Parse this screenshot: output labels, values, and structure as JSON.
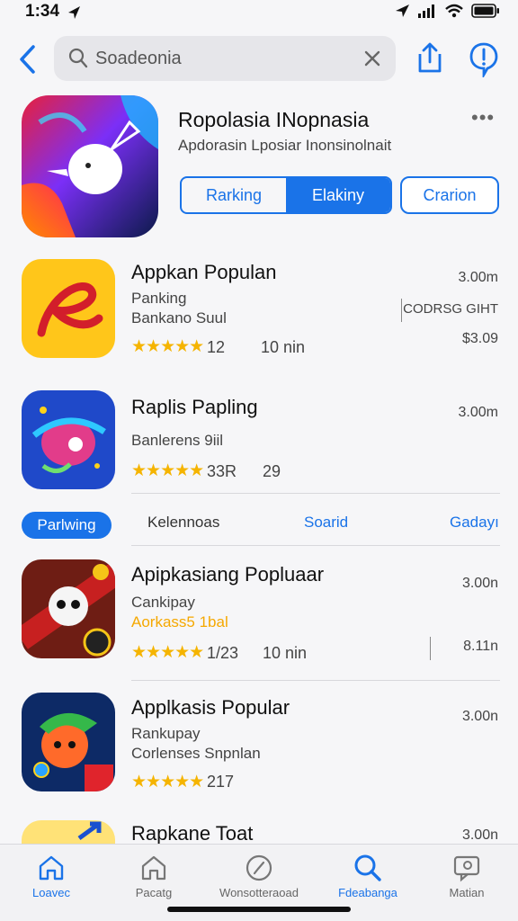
{
  "status": {
    "time": "1:34"
  },
  "search": {
    "value": "Soadeonia"
  },
  "hero": {
    "title": "Ropolasia INopnasia",
    "subtitle": "Apdorasin Lposiar Inonsinolnait",
    "more": "•••",
    "segments": [
      "Rarking",
      "Elakiny"
    ],
    "extra_button": "Crarion"
  },
  "apps": [
    {
      "title": "Appkan Populan",
      "line1": "Panking",
      "line2": "Bankano Suul",
      "rating": "12",
      "meta": "10 nin",
      "price": "3.00m",
      "right2": "CODRSG GIHT",
      "right3": "$3.09"
    },
    {
      "title": "Raplis Papling",
      "line1": "Banlerens 9iil",
      "rating": "33R",
      "meta": "29",
      "price": "3.00m"
    },
    {
      "title": "Apipkasiang Popluaar",
      "line1": "Cankipay",
      "line2": "Aorkass5 1bal",
      "rating": "1/23",
      "meta": "10 nin",
      "price": "3.00n",
      "right2": "8.11n"
    },
    {
      "title": "Applkasis Popular",
      "line1": "Rankupay",
      "line2": "Corlenses Snpnlan",
      "rating": "217",
      "price": "3.00n"
    },
    {
      "title": "Rapkane Toat",
      "price": "3.00n"
    }
  ],
  "tabs": {
    "active": "Parlwing",
    "items": [
      "Kelennoas",
      "Soarid",
      "Gadayı"
    ]
  },
  "bottom_nav": [
    "Loavec",
    "Pacatg",
    "Wonsotteraoad",
    "Fdeabanga",
    "Matian"
  ],
  "colors": {
    "accent": "#1a73e8",
    "star": "#f5b400"
  },
  "icons": [
    "back-chevron",
    "search",
    "clear-x",
    "share",
    "alert",
    "home",
    "house",
    "compass",
    "search",
    "chat"
  ]
}
